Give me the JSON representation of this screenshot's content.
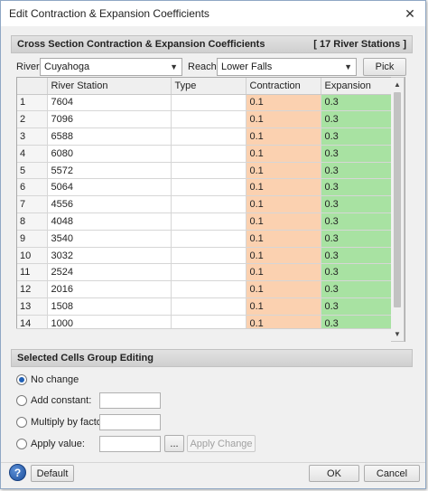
{
  "window": {
    "title": "Edit Contraction & Expansion Coefficients"
  },
  "section1": {
    "title": "Cross Section Contraction & Expansion Coefficients",
    "count_label": "[ 17 River Stations ]"
  },
  "controls": {
    "river_label": "River:",
    "river_value": "Cuyahoga",
    "reach_label": "Reach:",
    "reach_value": "Lower Falls",
    "pick_label": "Pick"
  },
  "table": {
    "columns": [
      "River Station",
      "Type",
      "Contraction",
      "Expansion"
    ],
    "rows": [
      {
        "num": "1",
        "station": "7604",
        "type": "",
        "contraction": "0.1",
        "expansion": "0.3"
      },
      {
        "num": "2",
        "station": "7096",
        "type": "",
        "contraction": "0.1",
        "expansion": "0.3"
      },
      {
        "num": "3",
        "station": "6588",
        "type": "",
        "contraction": "0.1",
        "expansion": "0.3"
      },
      {
        "num": "4",
        "station": "6080",
        "type": "",
        "contraction": "0.1",
        "expansion": "0.3"
      },
      {
        "num": "5",
        "station": "5572",
        "type": "",
        "contraction": "0.1",
        "expansion": "0.3"
      },
      {
        "num": "6",
        "station": "5064",
        "type": "",
        "contraction": "0.1",
        "expansion": "0.3"
      },
      {
        "num": "7",
        "station": "4556",
        "type": "",
        "contraction": "0.1",
        "expansion": "0.3"
      },
      {
        "num": "8",
        "station": "4048",
        "type": "",
        "contraction": "0.1",
        "expansion": "0.3"
      },
      {
        "num": "9",
        "station": "3540",
        "type": "",
        "contraction": "0.1",
        "expansion": "0.3"
      },
      {
        "num": "10",
        "station": "3032",
        "type": "",
        "contraction": "0.1",
        "expansion": "0.3"
      },
      {
        "num": "11",
        "station": "2524",
        "type": "",
        "contraction": "0.1",
        "expansion": "0.3"
      },
      {
        "num": "12",
        "station": "2016",
        "type": "",
        "contraction": "0.1",
        "expansion": "0.3"
      },
      {
        "num": "13",
        "station": "1508",
        "type": "",
        "contraction": "0.1",
        "expansion": "0.3"
      },
      {
        "num": "14",
        "station": "1000",
        "type": "",
        "contraction": "0.1",
        "expansion": "0.3"
      }
    ]
  },
  "section2": {
    "title": "Selected Cells Group Editing"
  },
  "group_editing": {
    "no_change": "No change",
    "add_constant": "Add constant:",
    "multiply": "Multiply by factor:",
    "apply_value": "Apply value:",
    "browse_label": "...",
    "apply_change_label": "Apply Change"
  },
  "footer": {
    "help": "?",
    "default_label": "Default",
    "ok_label": "OK",
    "cancel_label": "Cancel"
  },
  "colors": {
    "contraction_bg": "#fbd1b0",
    "expansion_bg": "#a8e2a2",
    "accent": "#1f5fb5"
  }
}
